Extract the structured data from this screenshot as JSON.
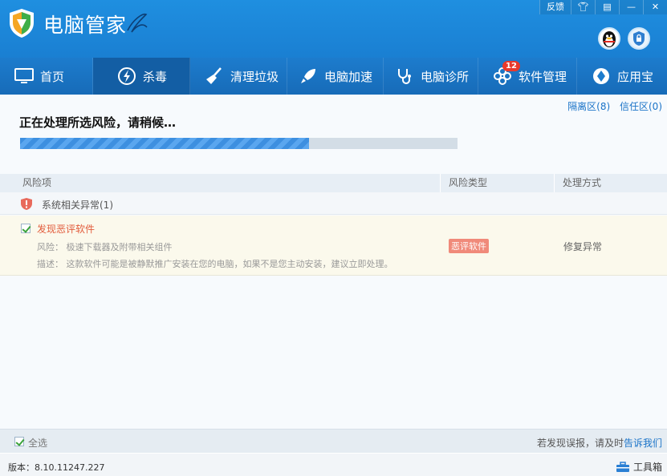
{
  "app": {
    "title": "电脑管家"
  },
  "top_controls": {
    "feedback": "反馈"
  },
  "nav": {
    "items": [
      {
        "label": "首页",
        "icon": "monitor-icon"
      },
      {
        "label": "杀毒",
        "icon": "lightning-shield-icon",
        "active": true
      },
      {
        "label": "清理垃圾",
        "icon": "broom-icon"
      },
      {
        "label": "电脑加速",
        "icon": "rocket-icon"
      },
      {
        "label": "电脑诊所",
        "icon": "stethoscope-icon"
      },
      {
        "label": "软件管理",
        "icon": "flower-icon",
        "badge": "12"
      },
      {
        "label": "应用宝",
        "icon": "app-store-icon"
      }
    ]
  },
  "main": {
    "quarantine_link": "隔离区(8)",
    "trust_link": "信任区(0)",
    "status": "正在处理所选风险，请稍候…",
    "progress": 0.66
  },
  "table": {
    "columns": [
      "风险项",
      "风险类型",
      "处理方式"
    ],
    "group": {
      "label": "系统相关异常(1)"
    },
    "item": {
      "title": "发现恶评软件",
      "risk": "风险： 极速下载器及附带相关组件",
      "description": "描述： 这款软件可能是被静默推广安装在您的电脑，如果不是您主动安装，建议立即处理。",
      "type": "恶评软件",
      "action": "修复异常"
    }
  },
  "footer": {
    "select_all": "全选",
    "feedback_text": "若发现误报，请及时",
    "feedback_link": "告诉我们",
    "version": "版本：8.10.11247.227",
    "toolbox": "工具箱"
  },
  "colors": {
    "header": "#1f8fe0",
    "nav_active": "#135ea4",
    "progress": "#3d8fe0",
    "risk_tag": "#f08a7a"
  }
}
